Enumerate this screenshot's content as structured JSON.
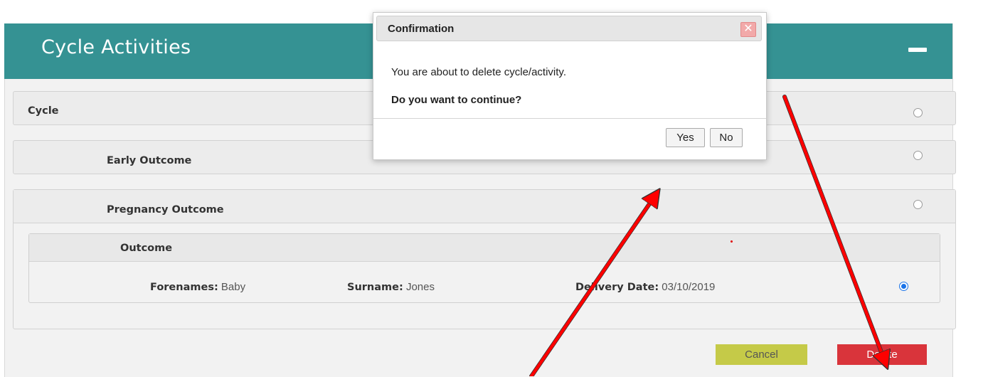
{
  "panel": {
    "title": "Cycle Activities"
  },
  "rows": {
    "cycle": "Cycle",
    "early_outcome": "Early Outcome",
    "pregnancy_outcome": "Pregnancy Outcome",
    "outcome": "Outcome"
  },
  "outcome_details": {
    "forenames_label": "Forenames:",
    "forenames_value": " Baby",
    "surname_label": "Surname:",
    "surname_value": " Jones",
    "delivery_label": "Delivery Date:",
    "delivery_value": " 03/10/2019"
  },
  "buttons": {
    "cancel": "Cancel",
    "delete": "Delete"
  },
  "dialog": {
    "title": "Confirmation",
    "close_symbol": "✕",
    "message": "You are about to delete cycle/activity.",
    "question": "Do you want to continue?",
    "yes": "Yes",
    "no": "No"
  },
  "colors": {
    "header": "#359293",
    "cancel": "#c5ca48",
    "delete": "#d9343b",
    "annotation_arrow": "#ff0000"
  },
  "icons": {
    "collapse": "minus-icon",
    "close": "close-icon"
  }
}
